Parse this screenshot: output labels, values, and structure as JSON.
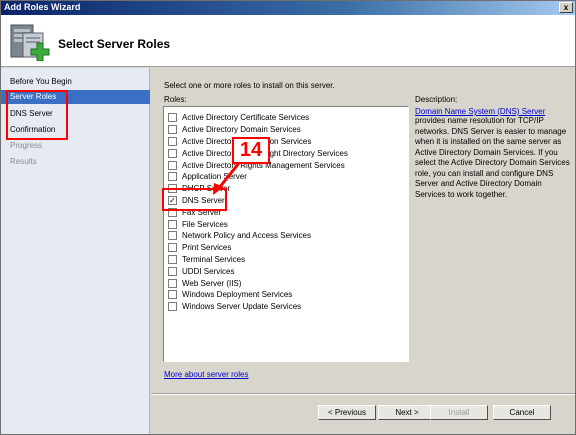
{
  "window": {
    "title": "Add Roles Wizard",
    "close_label": "x"
  },
  "header": {
    "title": "Select Server Roles",
    "icon": "server-roles-icon"
  },
  "nav": {
    "items": [
      {
        "label": "Before You Begin",
        "state": "normal"
      },
      {
        "label": "Server Roles",
        "state": "selected"
      },
      {
        "label": "DNS Server",
        "state": "normal"
      },
      {
        "label": "Confirmation",
        "state": "normal"
      },
      {
        "label": "Progress",
        "state": "dim"
      },
      {
        "label": "Results",
        "state": "dim"
      }
    ]
  },
  "main": {
    "instruction": "Select one or more roles to install on this server.",
    "roles_label": "Roles:",
    "roles": [
      {
        "label": "Active Directory Certificate Services",
        "checked": false
      },
      {
        "label": "Active Directory Domain Services",
        "checked": false
      },
      {
        "label": "Active Directory Federation Services",
        "checked": false
      },
      {
        "label": "Active Directory Lightweight Directory Services",
        "checked": false
      },
      {
        "label": "Active Directory Rights Management Services",
        "checked": false
      },
      {
        "label": "Application Server",
        "checked": false
      },
      {
        "label": "DHCP Server",
        "checked": false
      },
      {
        "label": "DNS Server",
        "checked": true
      },
      {
        "label": "Fax Server",
        "checked": false
      },
      {
        "label": "File Services",
        "checked": false
      },
      {
        "label": "Network Policy and Access Services",
        "checked": false
      },
      {
        "label": "Print Services",
        "checked": false
      },
      {
        "label": "Terminal Services",
        "checked": false
      },
      {
        "label": "UDDI Services",
        "checked": false
      },
      {
        "label": "Web Server (IIS)",
        "checked": false
      },
      {
        "label": "Windows Deployment Services",
        "checked": false
      },
      {
        "label": "Windows Server Update Services",
        "checked": false
      }
    ],
    "more_link": "More about server roles",
    "callout_number": "14"
  },
  "description": {
    "label": "Description:",
    "link": "Domain Name System (DNS) Server",
    "text": "provides name resolution for TCP/IP networks. DNS Server is easier to manage when it is installed on the same server as Active Directory Domain Services. If you select the Active Directory Domain Services role, you can install and configure DNS Server and Active Directory Domain Services to work together."
  },
  "buttons": {
    "previous": "< Previous",
    "next": "Next >",
    "install": "Install",
    "cancel": "Cancel"
  },
  "colors": {
    "accent": "#3a6fc4",
    "highlight": "#ff0000",
    "link": "#0000cc"
  }
}
